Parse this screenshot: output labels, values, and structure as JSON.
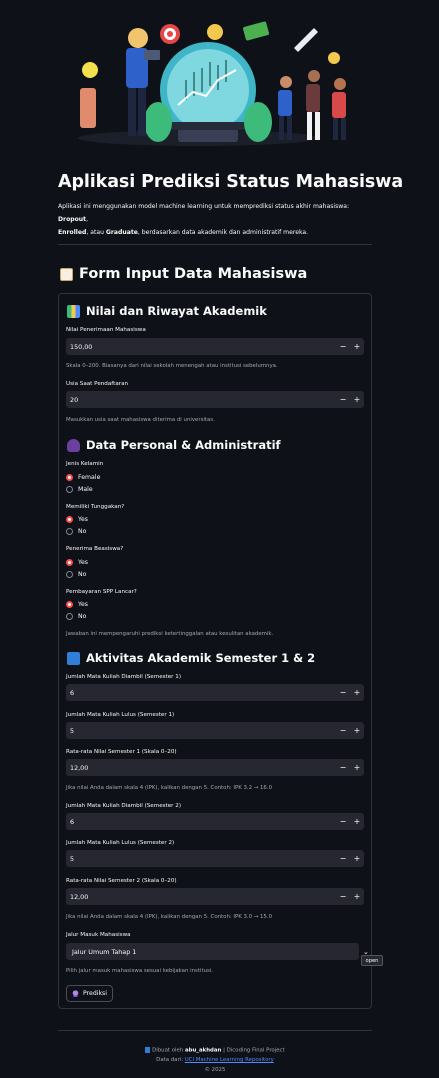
{
  "header": {
    "title": "Aplikasi Prediksi Status Mahasiswa",
    "intro_prefix": "Aplikasi ini menggunakan model machine learning untuk memprediksi status akhir mahasiswa: ",
    "dropout": "Dropout",
    "sep1": ",",
    "enrolled": "Enrolled",
    "sep2": ", atau ",
    "graduate": "Graduate",
    "intro_suffix": ", berdasarkan data akademik dan administratif mereka."
  },
  "form": {
    "title": "Form Input Data Mahasiswa",
    "section1": {
      "title": "Nilai dan Riwayat Akademik",
      "admission_label": "Nilai Penerimaan Mahasiswa",
      "admission_value": "150,00",
      "admission_help": "Skala 0–200. Biasanya dari nilai sekolah menengah atau institusi sebelumnya.",
      "age_label": "Usia Saat Pendaftaran",
      "age_value": "20",
      "age_help": "Masukkan usia saat mahasiswa diterima di universitas."
    },
    "section2": {
      "title": "Data Personal & Administratif",
      "gender_label": "Jenis Kelamin",
      "gender_opt1": "Female",
      "gender_opt2": "Male",
      "debtor_label": "Memiliki Tunggakan?",
      "scholar_label": "Penerima Beasiswa?",
      "fees_label": "Pembayaran SPP Lancar?",
      "yes": "Yes",
      "no": "No",
      "help": "Jawaban ini mempengaruhi prediksi ketertinggalan atau kesulitan akademik."
    },
    "section3": {
      "title": "Aktivitas Akademik Semester 1 & 2",
      "enrolled1_label": "Jumlah Mata Kuliah Diambil (Semester 1)",
      "enrolled1_value": "6",
      "approved1_label": "Jumlah Mata Kuliah Lulus (Semester 1)",
      "approved1_value": "5",
      "grade1_label": "Rata-rata Nilai Semester 1 (Skala 0–20)",
      "grade1_value": "12,00",
      "grade1_help": "Jika nilai Anda dalam skala 4 (IPK), kalikan dengan 5. Contoh: IPK 3.2 → 16.0",
      "enrolled2_label": "Jumlah Mata Kuliah Diambil (Semester 2)",
      "enrolled2_value": "6",
      "approved2_label": "Jumlah Mata Kuliah Lulus (Semester 2)",
      "approved2_value": "5",
      "grade2_label": "Rata-rata Nilai Semester 2 (Skala 0–20)",
      "grade2_value": "12,00",
      "grade2_help": "Jika nilai Anda dalam skala 4 (IPK), kalikan dengan 5. Contoh: IPK 3.0 → 15.0",
      "admission_mode_label": "Jalur Masuk Mahasiswa",
      "admission_mode_value": "Jalur Umum Tahap 1",
      "admission_mode_help": "Pilih jalur masuk mahasiswa sesuai kebijakan institusi.",
      "open_tooltip": "open"
    },
    "predict_label": "Prediksi",
    "minus": "−",
    "plus": "+"
  },
  "footer": {
    "made_by": "Dibuat oleh",
    "author": "abu_akhdan",
    "project": "| Dicoding Final Project",
    "data_from": "Data dari:",
    "data_link": "UCI Machine Learning Repository",
    "year": "© 2025"
  }
}
